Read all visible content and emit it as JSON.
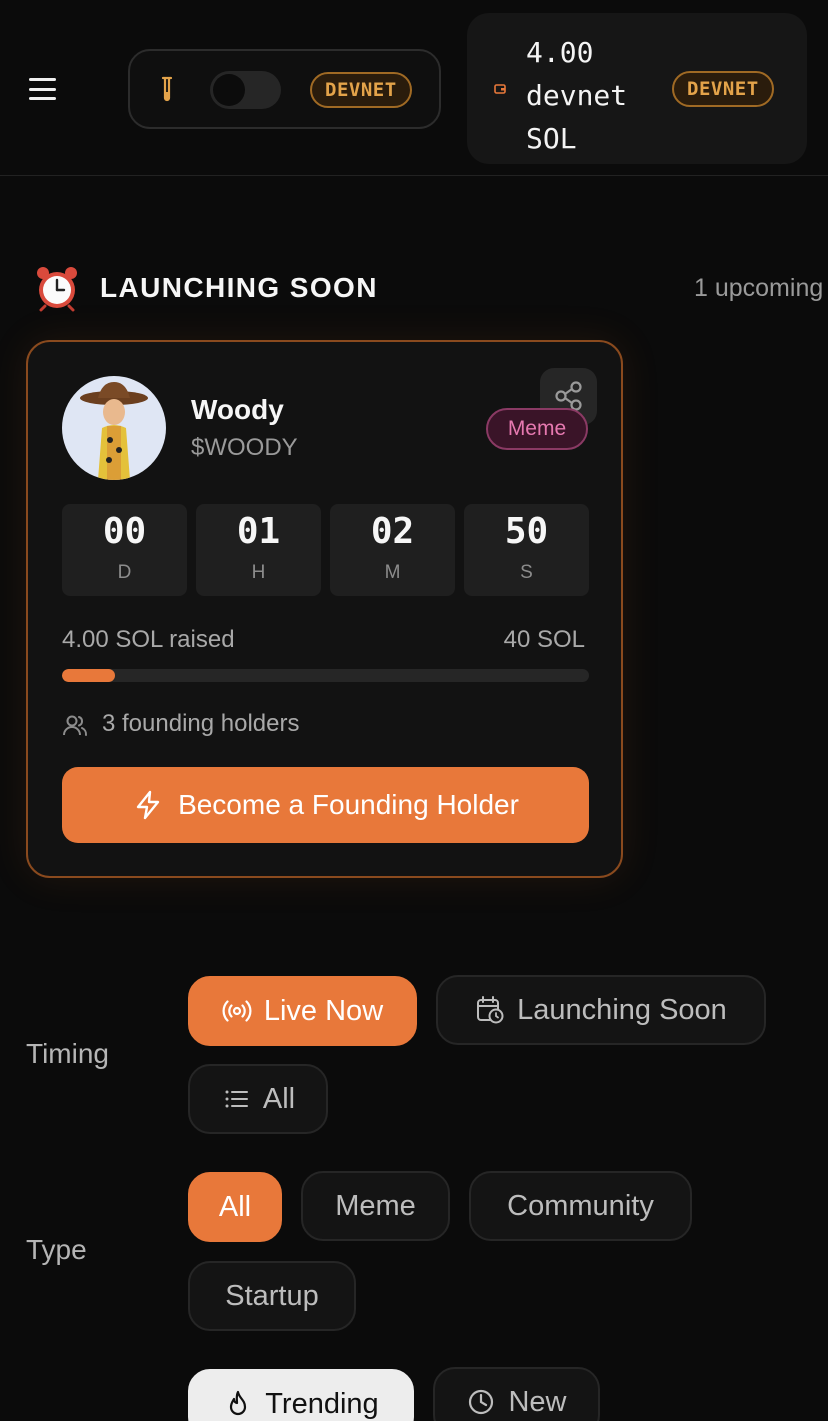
{
  "header": {
    "menu_icon": "hamburger-icon",
    "network_badge": "DEVNET",
    "wallet": {
      "balance_lines": [
        "4.00",
        "devnet",
        "SOL"
      ],
      "network_badge": "DEVNET"
    }
  },
  "section": {
    "icon": "alarm-clock-icon",
    "title": "LAUNCHING SOON",
    "count_text": "1 upcoming"
  },
  "card": {
    "name": "Woody",
    "ticker": "$WOODY",
    "tag": "Meme",
    "countdown": [
      {
        "value": "00",
        "unit": "D"
      },
      {
        "value": "01",
        "unit": "H"
      },
      {
        "value": "02",
        "unit": "M"
      },
      {
        "value": "50",
        "unit": "S"
      }
    ],
    "raised": "4.00 SOL raised",
    "goal": "40 SOL",
    "progress_fraction": 0.1,
    "holders": "3 founding holders",
    "cta": "Become a Founding Holder"
  },
  "filters": {
    "timing": {
      "label": "Timing",
      "options": [
        "Live Now",
        "Launching Soon",
        "All"
      ],
      "selected": "Live Now"
    },
    "type": {
      "label": "Type",
      "options": [
        "All",
        "Meme",
        "Community",
        "Startup"
      ],
      "selected": "All"
    },
    "sort": {
      "options": [
        "Trending",
        "New"
      ],
      "selected": "Trending"
    }
  },
  "colors": {
    "accent": "#e8783a",
    "badge_text": "#e3a34a",
    "meme_tag": "#e679b0",
    "background": "#0b0b0b"
  }
}
